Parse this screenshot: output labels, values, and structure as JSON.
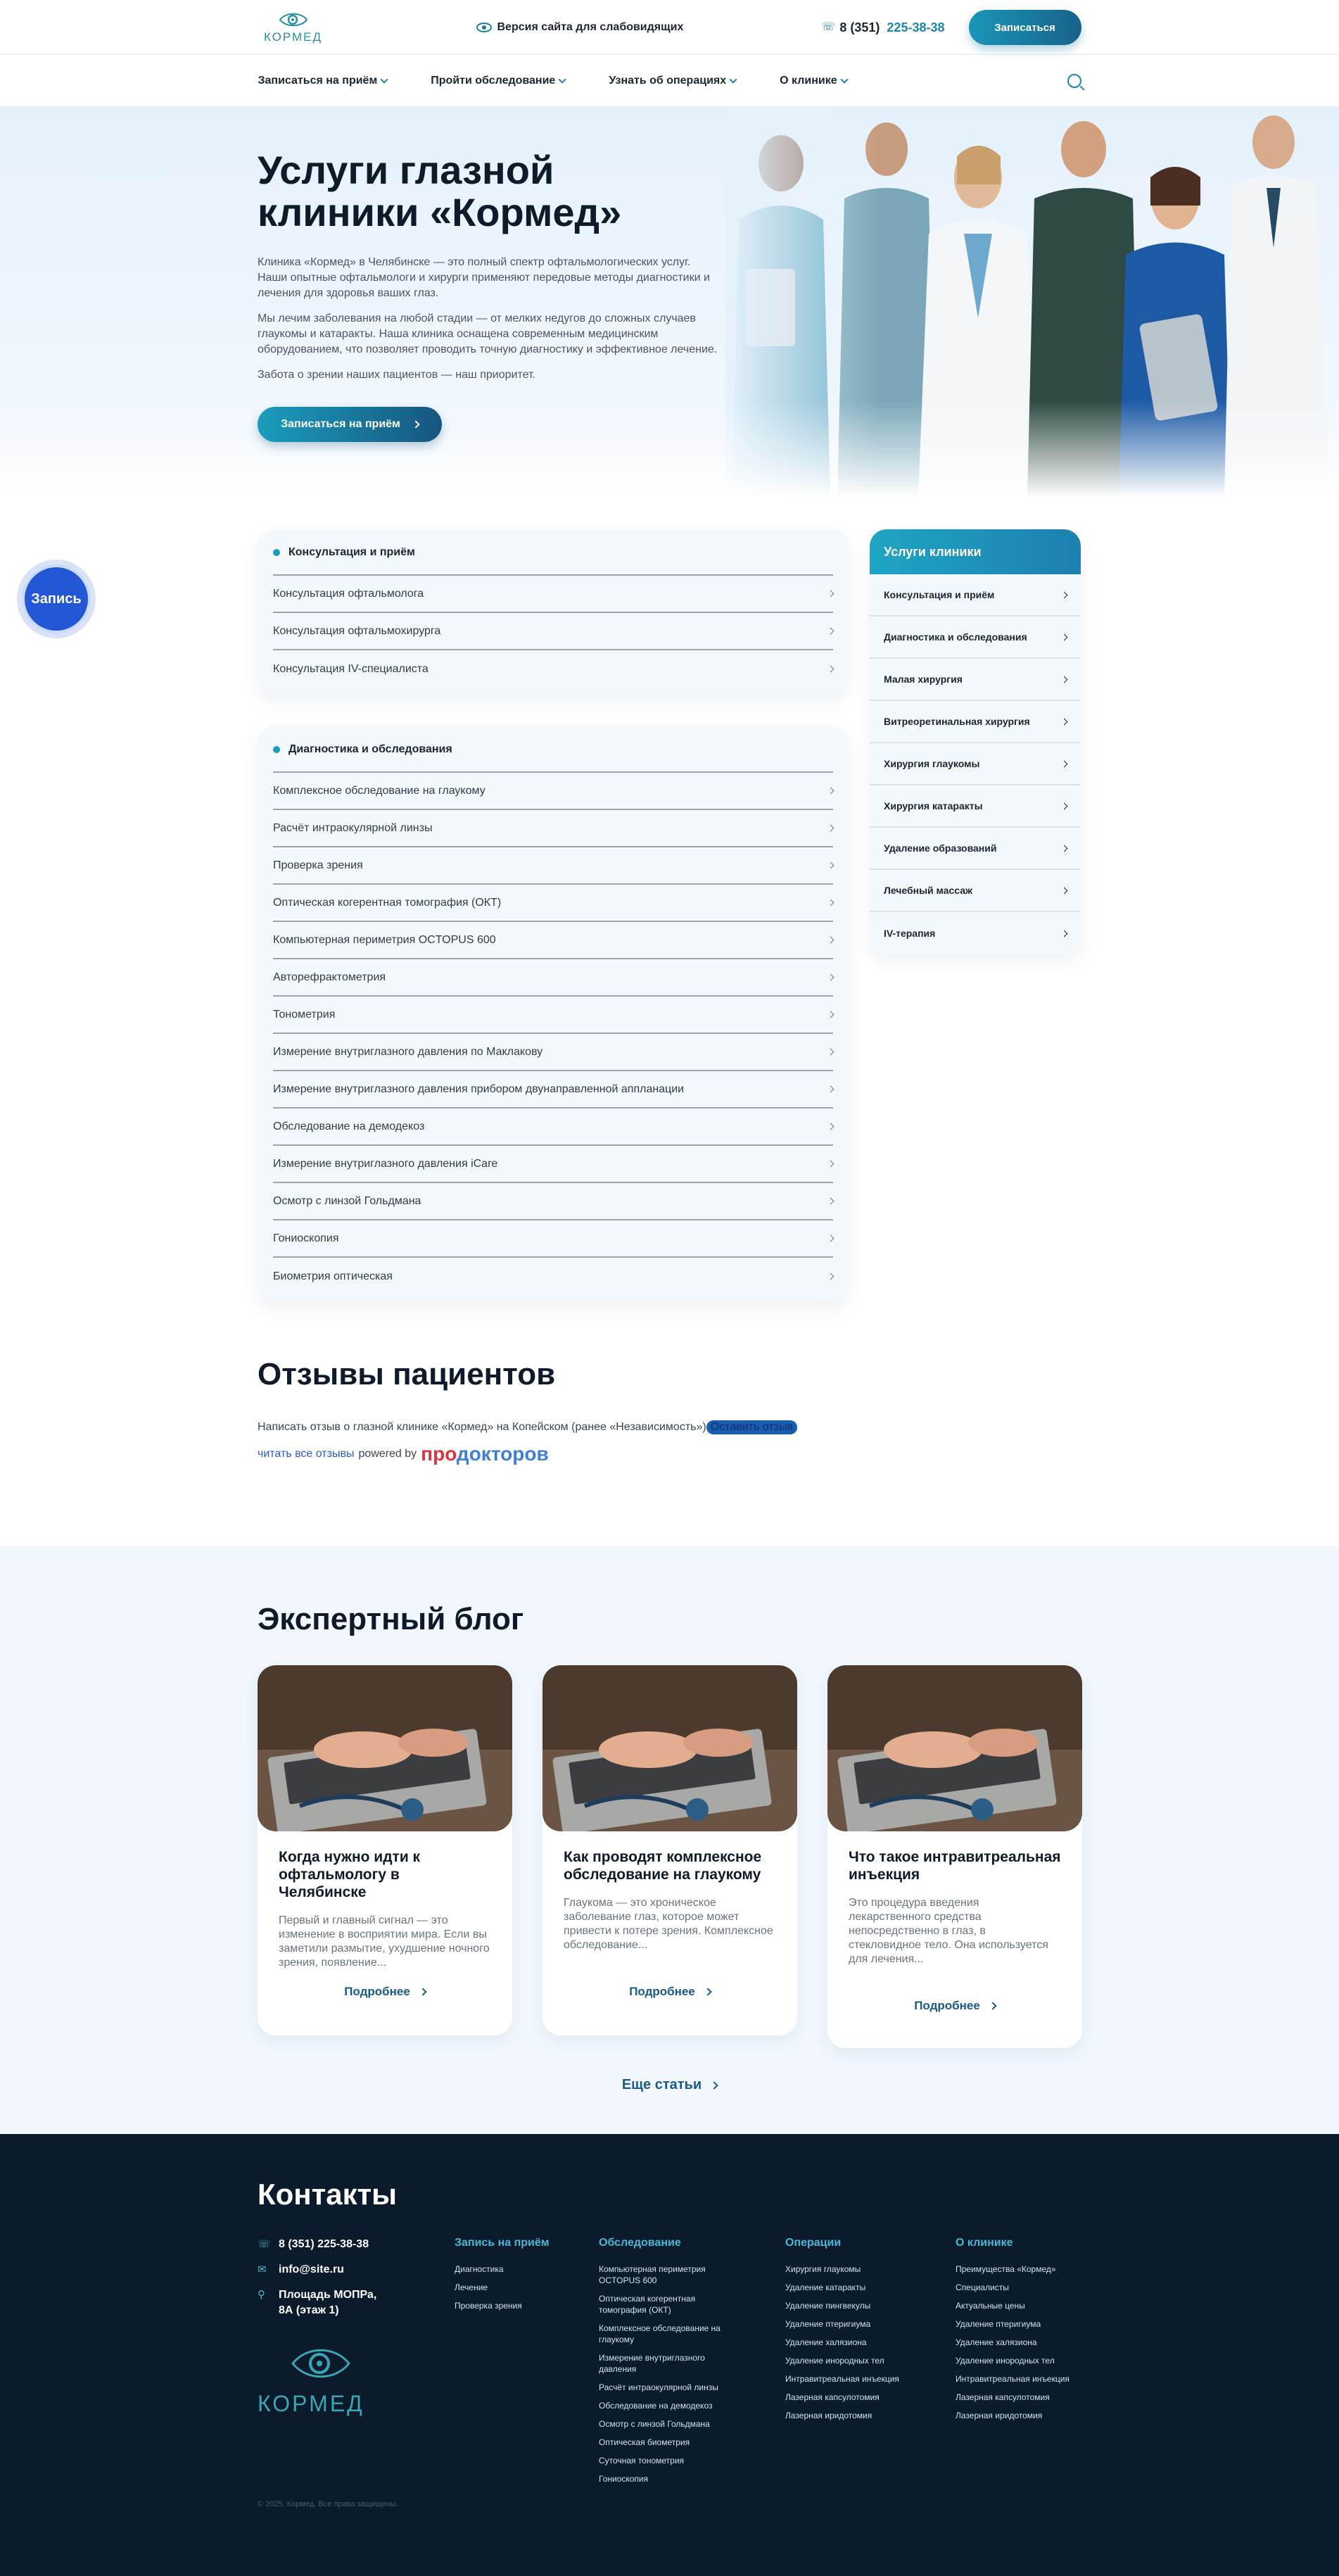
{
  "header": {
    "logo_text": "КОРМЕД",
    "low_vision": "Версия сайта для слабовидящих",
    "phone_code": "8 (351)",
    "phone_number": "225-38-38",
    "cta": "Записаться"
  },
  "nav": {
    "items": [
      {
        "label": "Записаться на приём"
      },
      {
        "label": "Пройти обследование"
      },
      {
        "label": "Узнать об операциях"
      },
      {
        "label": "О клинике"
      }
    ]
  },
  "hero": {
    "title_line1": "Услуги глазной",
    "title_line2": "клиники «Кормед»",
    "p1": "Клиника «Кормед» в Челябинске — это полный спектр офтальмологических услуг. Наши опытные офтальмологи и хирурги применяют передовые методы диагностики и лечения для здоровья ваших глаз.",
    "p2": "Мы лечим заболевания на любой стадии — от мелких недугов до сложных случаев глаукомы и катаракты. Наша клиника оснащена современным медицинским оборудованием, что позволяет проводить точную диагностику и эффективное лечение.",
    "p3": "Забота о зрении наших пациентов — наш приоритет.",
    "cta": "Записаться на приём"
  },
  "float_button": "Запись",
  "consult": {
    "title": "Консультация и приём",
    "rows": [
      "Консультация офтальмолога",
      "Консультация офтальмохирурга",
      "Консультация IV-специалиста"
    ]
  },
  "diag": {
    "title": "Диагностика и обследования",
    "rows": [
      "Комплексное обследование на глаукому",
      "Расчёт интраокулярной линзы",
      "Проверка зрения",
      "Оптическая когерентная томография (ОКТ)",
      "Компьютерная периметрия OCTOPUS 600",
      "Авторефрактометрия",
      "Тонометрия",
      "Измерение внутриглазного давления по Маклакову",
      "Измерение внутриглазного давления прибором двунаправленной аппланации",
      "Обследование на демодекоз",
      "Измерение внутриглазного давления iCare",
      "Осмотр с линзой Гольдмана",
      "Гониоскопия",
      "Биометрия оптическая"
    ]
  },
  "sidebar": {
    "title": "Услуги клиники",
    "items": [
      "Консультация и приём",
      "Диагностика и обследования",
      "Малая хирургия",
      "Витреоретинальная хирургия",
      "Хирургия глаукомы",
      "Хирургия катаракты",
      "Удаление образований",
      "Лечебный массаж",
      "IV-терапия"
    ]
  },
  "reviews": {
    "title": "Отзывы пациентов",
    "text": "Написать отзыв о глазной клинике «Кормед» на Копейском (ранее «Независимость»)",
    "leave": "Оставить отзыв",
    "read_all": "читать все отзывы",
    "powered": "powered by",
    "brand_a": "про",
    "brand_b": "докторов"
  },
  "blog": {
    "title": "Экспертный блог",
    "posts": [
      {
        "title": "Когда нужно идти к офтальмологу в Челябинске",
        "excerpt": "Первый и главный сигнал — это изменение в восприятии мира. Если вы заметили размытие, ухудшение ночного зрения, появление...",
        "more": "Подробнее"
      },
      {
        "title": "Как проводят комплексное обследование на глаукому",
        "excerpt": "Глаукома — это хроническое заболевание глаз, которое может привести к потере зрения. Комплексное обследование...",
        "more": "Подробнее"
      },
      {
        "title": "Что такое интравитреальная инъекция",
        "excerpt": "Это процедура введения лекарственного средства непосредственно в глаз, в стекловидное тело. Она используется для лечения...",
        "more": "Подробнее"
      }
    ],
    "more_articles": "Еще статьи"
  },
  "footer": {
    "title": "Контакты",
    "phone": "8 (351) 225-38-38",
    "email": "info@site.ru",
    "address_line1": "Площадь МОПРа,",
    "address_line2": "8А (этаж 1)",
    "logo_text": "КОРМЕД",
    "col1": {
      "title": "Запись на приём",
      "items": [
        "Диагностика",
        "Лечение",
        "Проверка зрения"
      ]
    },
    "col2": {
      "title": "Обследование",
      "items": [
        "Компьютерная периметрия OCTOPUS 600",
        "Оптическая когерентная томография (ОКТ)",
        "Комплексное обследование на глаукому",
        "Измерение внутриглазного давления",
        "Расчёт интраокулярной линзы",
        "Обследование на демодекоз",
        "Осмотр с линзой Гольдмана",
        "Оптическая биометрия",
        "Суточная тонометрия",
        "Гониоскопия"
      ]
    },
    "col3": {
      "title": "Операции",
      "items": [
        "Хирургия глаукомы",
        "Удаление катаракты",
        "Удаление пингвекулы",
        "Удаление птеригиума",
        "Удаление халязиона",
        "Удаление инородных тел",
        "Интравитреальная инъекция",
        "Лазерная капсулотомия",
        "Лазерная иридотомия"
      ]
    },
    "col4": {
      "title": "О клинике",
      "items": [
        "Преимущества «Кормед»",
        "Специалисты",
        "Актуальные цены",
        "Удаление птеригиума",
        "Удаление халязиона",
        "Удаление инородных тел",
        "Интравитреальная инъекция",
        "Лазерная капсулотомия",
        "Лазерная иридотомия"
      ]
    },
    "copyright": "© 2025. Кормед. Все права защищены."
  },
  "colors": {
    "accent": "#1c86b3",
    "footer_bg": "#0c1b2b",
    "float_button": "#2357d6"
  }
}
